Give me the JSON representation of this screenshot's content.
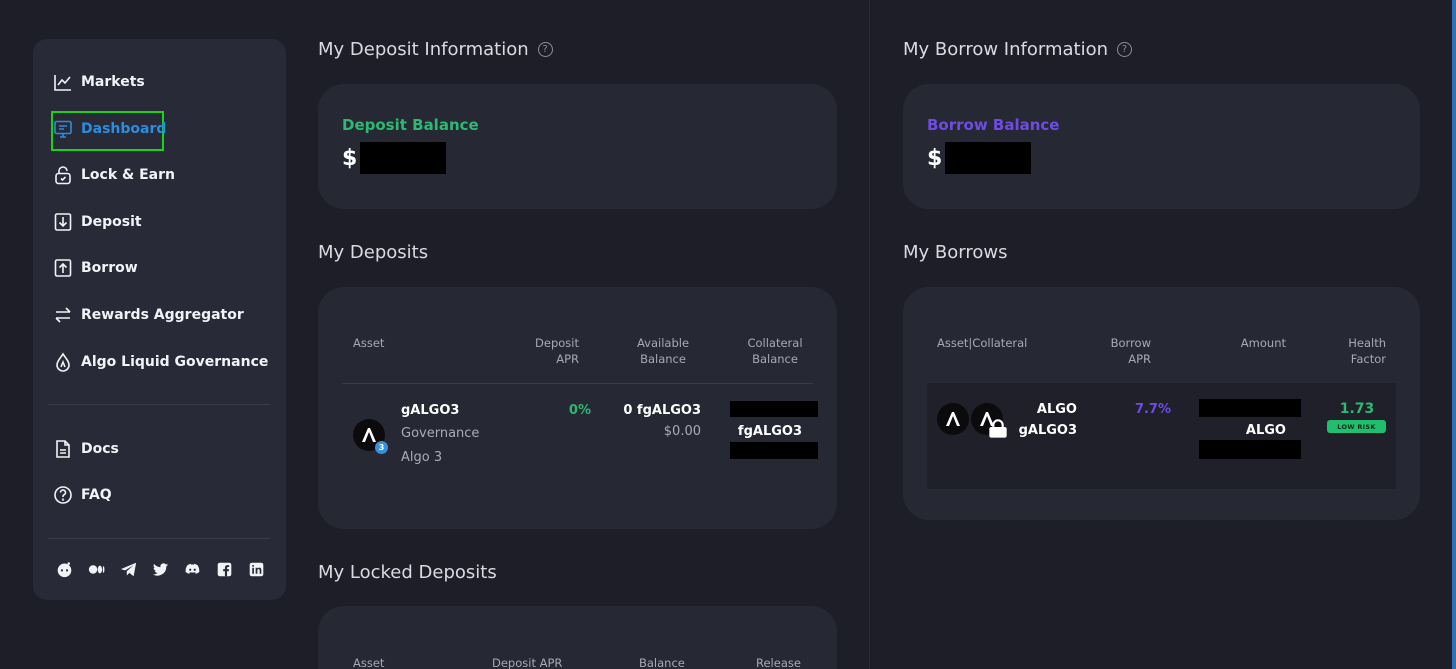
{
  "sidebar": {
    "items": [
      {
        "label": "Markets",
        "icon": "chart-line-icon"
      },
      {
        "label": "Dashboard",
        "icon": "monitor-icon"
      },
      {
        "label": "Lock & Earn",
        "icon": "lock-icon"
      },
      {
        "label": "Deposit",
        "icon": "download-icon"
      },
      {
        "label": "Borrow",
        "icon": "upload-icon"
      },
      {
        "label": "Rewards Aggregator",
        "icon": "swap-arrows-icon"
      },
      {
        "label": "Algo Liquid Governance",
        "icon": "drop-icon"
      }
    ],
    "secondary": [
      {
        "label": "Docs",
        "icon": "document-icon"
      },
      {
        "label": "FAQ",
        "icon": "question-icon"
      }
    ],
    "active": "Dashboard",
    "socials": [
      "reddit-icon",
      "medium-icon",
      "telegram-icon",
      "twitter-icon",
      "discord-icon",
      "facebook-icon",
      "linkedin-icon"
    ]
  },
  "deposit_info": {
    "title": "My Deposit Information",
    "balance_label": "Deposit Balance",
    "currency": "$"
  },
  "borrow_info": {
    "title": "My Borrow Information",
    "balance_label": "Borrow Balance",
    "currency": "$"
  },
  "deposits": {
    "title": "My Deposits",
    "headers": {
      "asset": "Asset",
      "apr_1": "Deposit",
      "apr_2": "APR",
      "avail_1": "Available",
      "avail_2": "Balance",
      "coll_1": "Collateral",
      "coll_2": "Balance"
    },
    "row": {
      "name": "gALGO3",
      "sub_1": "Governance",
      "sub_2": "Algo 3",
      "badge": "3",
      "apr": "0%",
      "available": "0 fgALGO3",
      "available_usd": "$0.00",
      "collateral": "fgALGO3"
    }
  },
  "borrows": {
    "title": "My Borrows",
    "headers": {
      "asset": "Asset|Collateral",
      "apr_1": "Borrow",
      "apr_2": "APR",
      "amount": "Amount",
      "hf_1": "Health",
      "hf_2": "Factor"
    },
    "row": {
      "asset": "ALGO",
      "collateral": "gALGO3",
      "apr": "7.7%",
      "amount_unit": "ALGO",
      "health": "1.73",
      "risk": "LOW RISK"
    }
  },
  "locked": {
    "title": "My Locked Deposits",
    "headers": {
      "asset": "Asset",
      "apr": "Deposit APR",
      "balance": "Balance",
      "release": "Release"
    }
  },
  "colors": {
    "background": "#1d1e27",
    "card": "#262834",
    "deposit_accent": "#2eb872",
    "borrow_accent": "#6f4be6",
    "active_nav": "#2b8ce0",
    "highlight_box": "#19d219"
  }
}
